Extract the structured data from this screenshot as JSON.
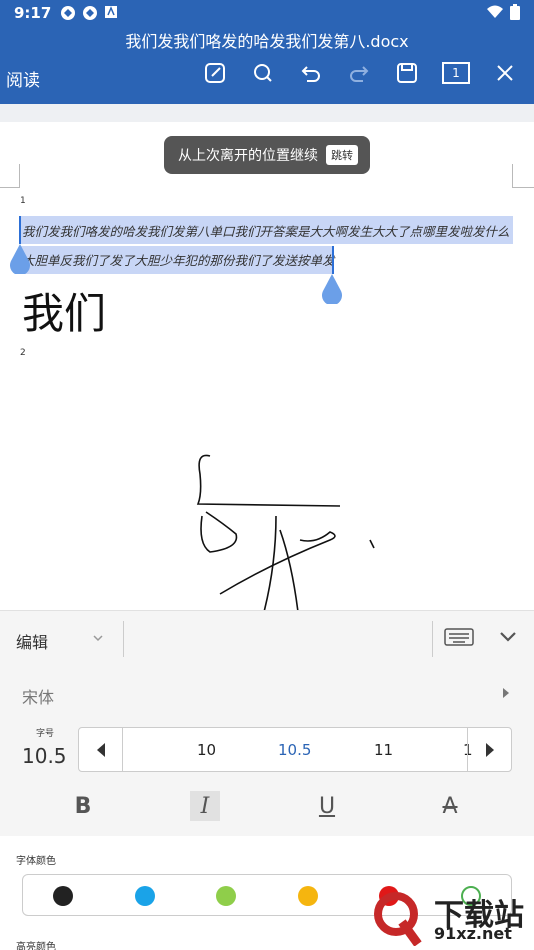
{
  "status_bar": {
    "time": "9:17",
    "left_icons": [
      "notification-icon",
      "notification-icon",
      "app-icon"
    ],
    "right_icons": [
      "wifi-icon",
      "battery-icon"
    ]
  },
  "header": {
    "title": "我们发我们咯发的哈发我们发第八.docx",
    "mode_label": "阅读",
    "page_count": "1",
    "bg_color": "#2b64b5"
  },
  "document": {
    "toast_text": "从上次离开的位置继续",
    "toast_button": "跳转",
    "para_numbers": [
      "1",
      "2"
    ],
    "para1_line1": "我们发我们咯发的哈发我们发第八单口我们开答案是大大啊发生大大了点哪里发啦发什么",
    "para1_line2": "大胆单反我们了发了大胆少年犯的那份我们了发送按单发",
    "big_text": "我们"
  },
  "panel": {
    "edit_label": "编辑",
    "font_name": "宋体",
    "size_label": "字号",
    "size_value": "10.5",
    "size_options": [
      "10",
      "10.5",
      "11",
      "1"
    ],
    "selected_size": "10.5",
    "styles": [
      "B",
      "I",
      "U",
      "A"
    ],
    "font_color_label": "字体颜色",
    "colors": [
      "#222222",
      "#1aa3e8",
      "#8fce4a",
      "#f5b50f",
      "#e01818",
      "#ffffff"
    ],
    "highlight_label": "高亮颜色"
  },
  "watermark": {
    "text": "下载站",
    "url": "91xz.net"
  }
}
